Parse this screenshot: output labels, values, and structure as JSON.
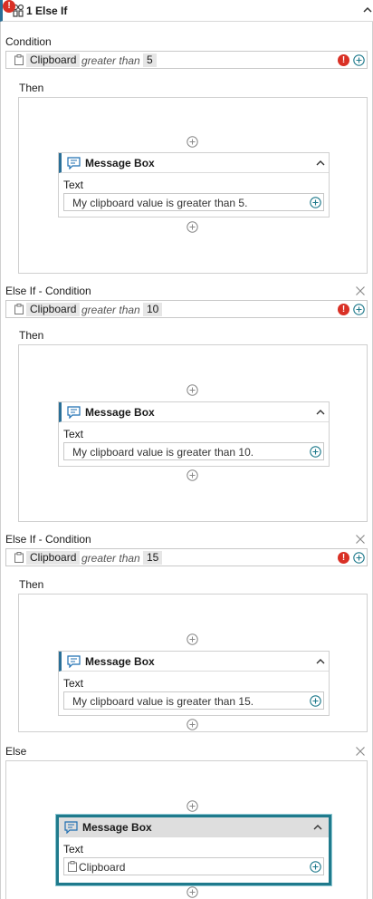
{
  "header": {
    "title": "1 Else If"
  },
  "condition_label": "Condition",
  "then_label": "Then",
  "else_if_label": "Else If - Condition",
  "else_label": "Else",
  "branches": [
    {
      "chip": "Clipboard",
      "operator": "greater than",
      "value": "5",
      "mbox_title": "Message Box",
      "text_label": "Text",
      "text_value": "My clipboard value is greater than 5."
    },
    {
      "chip": "Clipboard",
      "operator": "greater than",
      "value": "10",
      "mbox_title": "Message Box",
      "text_label": "Text",
      "text_value": "My clipboard value is greater than 10."
    },
    {
      "chip": "Clipboard",
      "operator": "greater than",
      "value": "15",
      "mbox_title": "Message Box",
      "text_label": "Text",
      "text_value": "My clipboard value is greater than 15."
    }
  ],
  "else_box": {
    "mbox_title": "Message Box",
    "text_label": "Text",
    "text_value": "Clipboard"
  },
  "icons": {
    "header": "else-if-icon",
    "error": "error-icon",
    "add": "add-icon",
    "collapse": "chevron-up-icon",
    "close": "close-icon",
    "message": "message-box-icon",
    "clipboard": "clipboard-icon"
  },
  "colors": {
    "accent": "#2a6f97",
    "error": "#d93025",
    "selection": "#1f7a8c"
  }
}
